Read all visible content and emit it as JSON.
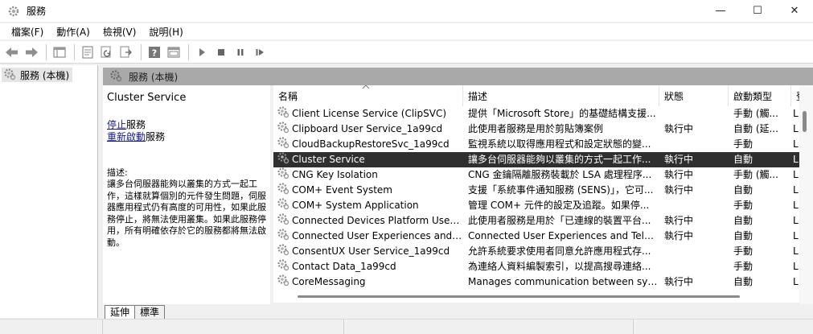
{
  "window": {
    "title": "服務",
    "minimize_glyph": "—",
    "maximize_glyph": "☐",
    "close_glyph": "✕"
  },
  "menu": [
    {
      "label": "檔案(F)"
    },
    {
      "label": "動作(A)"
    },
    {
      "label": "檢視(V)"
    },
    {
      "label": "說明(H)"
    }
  ],
  "toolbar": {
    "icons": [
      "back-arrow-icon",
      "forward-arrow-icon",
      "console-tree-icon",
      "properties-icon",
      "refresh-icon",
      "export-list-icon",
      "help-icon",
      "show-hide-pane-icon",
      "start-service-icon",
      "stop-service-icon",
      "pause-service-icon",
      "restart-service-icon"
    ]
  },
  "tree": {
    "root_label": "服務 (本機)"
  },
  "right_header": {
    "label": "服務 (本機)"
  },
  "extended": {
    "service_title": "Cluster Service",
    "stop_link": "停止",
    "stop_suffix": "服務",
    "restart_link": "重新啟動",
    "restart_suffix": "服務",
    "description_label": "描述:",
    "description": "讓多台伺服器能夠以叢集的方式一起工作，這樣就算個別的元件發生問題，伺服器應用程式仍有高度的可用性，如果此服務停止，將無法使用叢集。如果此服務停用，所有明確依存於它的服務都將無法啟動。"
  },
  "list": {
    "columns": {
      "name": "名稱",
      "description": "描述",
      "status": "狀態",
      "startup": "啟動類型",
      "logon": "登"
    },
    "rows": [
      {
        "name": "Client License Service (ClipSVC)",
        "description": "提供「Microsoft Store」的基礎結構支援...",
        "status": "",
        "startup": "手動 (觸...",
        "logon": "L"
      },
      {
        "name": "Clipboard User Service_1a99cd",
        "description": "此使用者服務是用於剪貼簿案例",
        "status": "執行中",
        "startup": "自動 (延...",
        "logon": "L"
      },
      {
        "name": "CloudBackupRestoreSvc_1a99cd",
        "description": "監視系統以取得應用程式和設定狀態的變...",
        "status": "",
        "startup": "手動",
        "logon": "L"
      },
      {
        "name": "Cluster Service",
        "description": "讓多台伺服器能夠以叢集的方式一起工作...",
        "status": "執行中",
        "startup": "自動",
        "logon": "L",
        "selected": true
      },
      {
        "name": "CNG Key Isolation",
        "description": "CNG 金鑰隔離服務裝載於 LSA 處理程序...",
        "status": "執行中",
        "startup": "手動 (觸...",
        "logon": "L"
      },
      {
        "name": "COM+ Event System",
        "description": "支援「系統事件通知服務 (SENS)」，它可...",
        "status": "執行中",
        "startup": "自動",
        "logon": "L"
      },
      {
        "name": "COM+ System Application",
        "description": "管理 COM+ 元件的設定及追蹤。如果停...",
        "status": "",
        "startup": "手動",
        "logon": "L"
      },
      {
        "name": "Connected Devices Platform User S...",
        "description": "此使用者服務是用於「已連線的裝置平台...",
        "status": "執行中",
        "startup": "自動",
        "logon": "L"
      },
      {
        "name": "Connected User Experiences and Te...",
        "description": "Connected User Experiences and Telem...",
        "status": "執行中",
        "startup": "自動",
        "logon": "L"
      },
      {
        "name": "ConsentUX User Service_1a99cd",
        "description": "允許系統要求使用者同意允許應用程式存...",
        "status": "",
        "startup": "手動",
        "logon": "L"
      },
      {
        "name": "Contact Data_1a99cd",
        "description": "為連絡人資料編製索引，以提高搜尋連絡...",
        "status": "",
        "startup": "手動",
        "logon": "L"
      },
      {
        "name": "CoreMessaging",
        "description": "Manages communication between syst...",
        "status": "執行中",
        "startup": "自動",
        "logon": "L"
      }
    ]
  },
  "tabs": [
    {
      "label": "延伸",
      "active": true
    },
    {
      "label": "標準",
      "active": false
    }
  ]
}
